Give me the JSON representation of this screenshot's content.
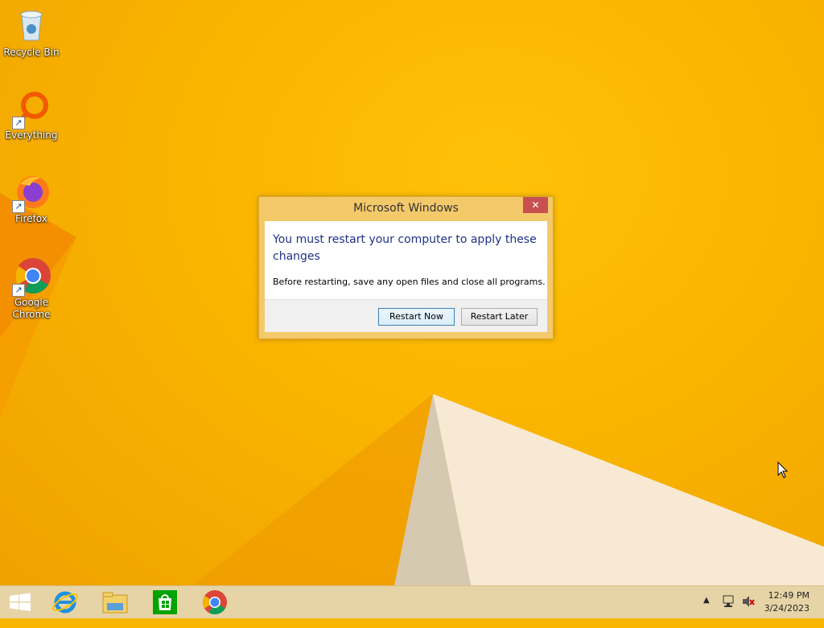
{
  "desktop": {
    "icons": [
      {
        "label": "Recycle Bin",
        "icon": "recycle-bin-icon"
      },
      {
        "label": "Everything",
        "icon": "everything-icon"
      },
      {
        "label": "Firefox",
        "icon": "firefox-icon"
      },
      {
        "label": "Google Chrome",
        "icon": "chrome-icon"
      }
    ]
  },
  "dialog": {
    "title": "Microsoft Windows",
    "close_label": "✕",
    "headline": "You must restart your computer to apply these changes",
    "body": "Before restarting, save any open files and close all programs.",
    "primary_button": "Restart Now",
    "secondary_button": "Restart Later"
  },
  "taskbar": {
    "items": [
      "start-icon",
      "internet-explorer-icon",
      "file-explorer-icon",
      "store-icon",
      "chrome-icon"
    ],
    "tray": {
      "icons": [
        "show-hidden-icons",
        "network-icon",
        "volume-muted-icon"
      ]
    },
    "clock": {
      "time": "12:49 PM",
      "date": "3/24/2023"
    }
  },
  "colors": {
    "wallpaper": "#f9b400",
    "dialog_frame": "#f4c96a",
    "headline": "#1e3287",
    "close": "#c75050"
  }
}
